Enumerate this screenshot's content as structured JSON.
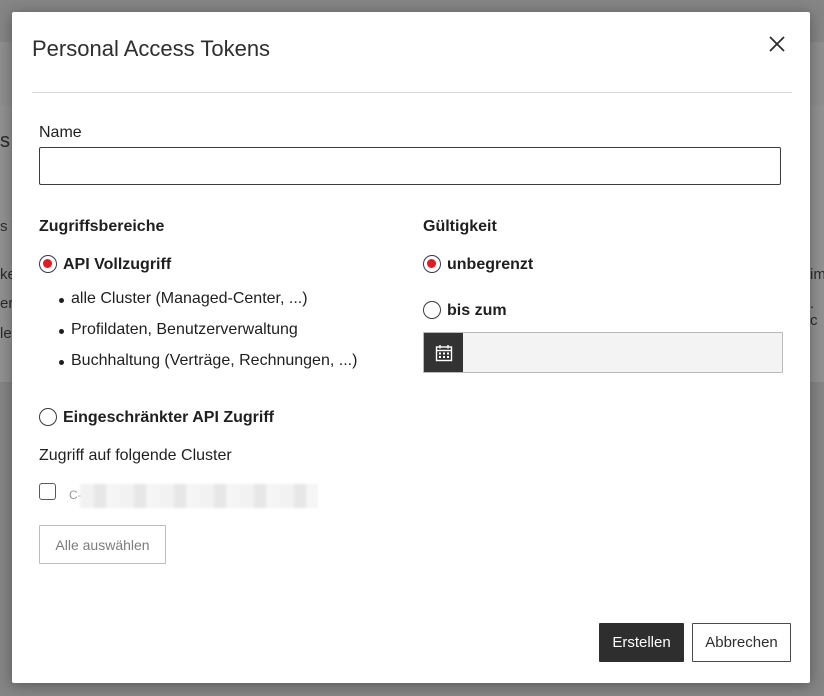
{
  "background": {
    "fragments": [
      "s",
      "s T",
      "ke",
      "er",
      "le",
      "im",
      ". c"
    ]
  },
  "modal": {
    "title": "Personal Access Tokens",
    "close_icon": "close-icon"
  },
  "form": {
    "name_label": "Name",
    "name_value": "",
    "scopes": {
      "heading": "Zugriffsbereiche",
      "full_access_label": "API Vollzugriff",
      "full_access_selected": true,
      "full_access_items": [
        "alle Cluster (Managed-Center, ...)",
        "Profildaten, Benutzerverwaltung",
        "Buchhaltung (Verträge, Rechnungen, ...)"
      ],
      "restricted_label": "Eingeschränkter API Zugriff",
      "restricted_selected": false,
      "cluster_access_label": "Zugriff auf folgende Cluster",
      "cluster_prefix": "C-",
      "cluster_checked": false,
      "select_all_label": "Alle auswählen"
    },
    "validity": {
      "heading": "Gültigkeit",
      "unlimited_label": "unbegrenzt",
      "unlimited_selected": true,
      "until_label": "bis zum",
      "until_selected": false,
      "date_value": "",
      "calendar_icon": "calendar-icon"
    }
  },
  "actions": {
    "create_label": "Erstellen",
    "cancel_label": "Abbrechen"
  },
  "colors": {
    "accent_radio": "#e01b24",
    "primary_button": "#2e2e2e",
    "overlay": "#858585"
  }
}
